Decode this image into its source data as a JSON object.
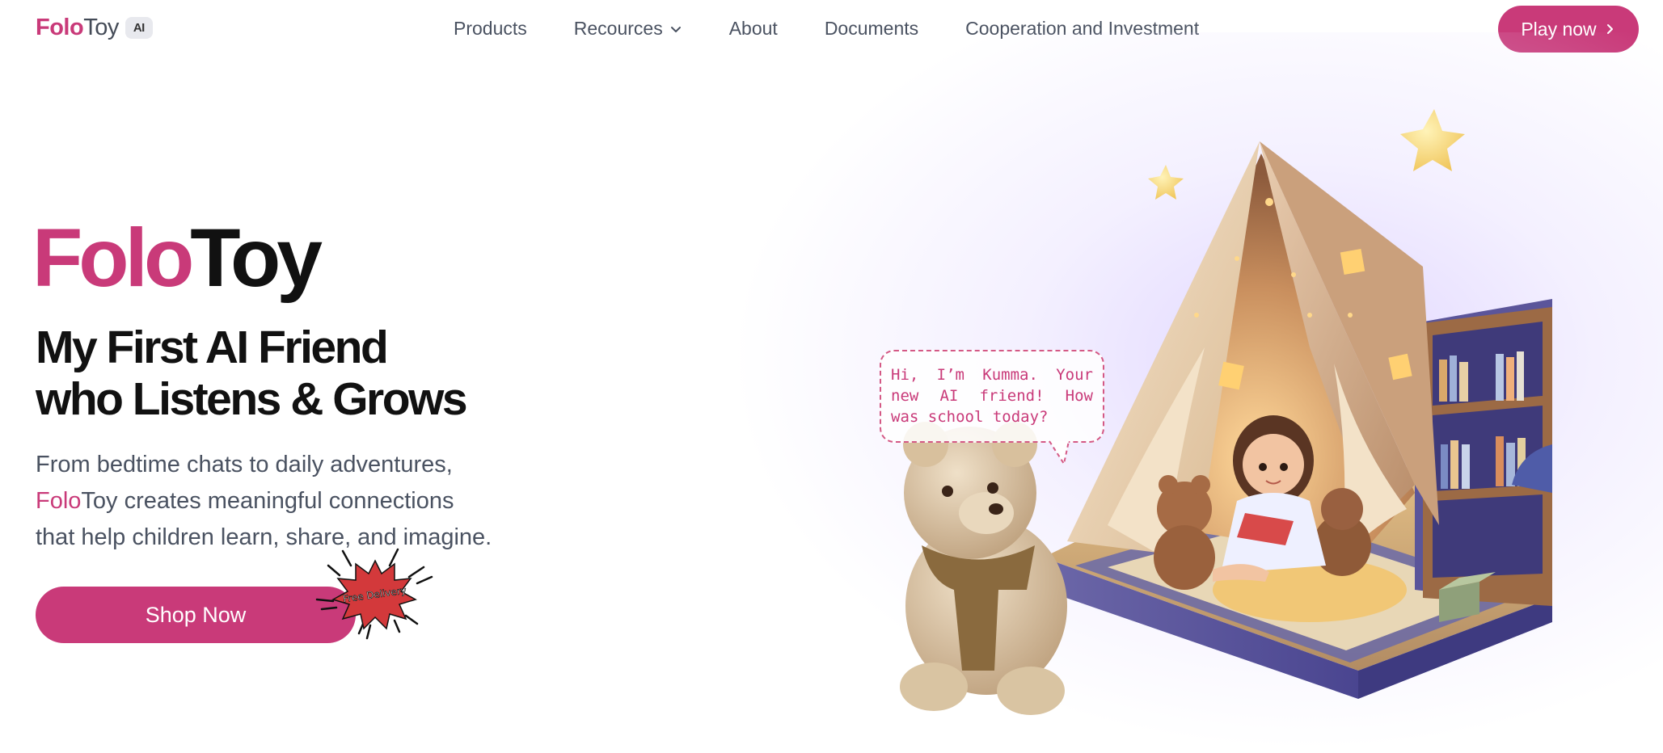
{
  "nav": {
    "logo_folo": "Folo",
    "logo_toy": "Toy",
    "logo_badge": "AI",
    "links": [
      {
        "label": "Products"
      },
      {
        "label": "Recources",
        "has_dropdown": true
      },
      {
        "label": "About"
      },
      {
        "label": "Documents"
      },
      {
        "label": "Cooperation and Investment"
      }
    ],
    "cta_label": "Play now"
  },
  "hero": {
    "brand_folo": "Folo",
    "brand_toy": "Toy",
    "headline_line1": "My First AI Friend",
    "headline_line2": "who Listens & Grows",
    "desc_line1": "From bedtime chats to daily adventures,",
    "desc_folo": "Folo",
    "desc_line2_rest": "Toy creates meaningful connections",
    "desc_line3": "that help children learn, share, and imagine.",
    "shop_label": "Shop Now",
    "badge_label": "Free Delivery"
  },
  "illustration": {
    "speech_bubble": "Hi, I’m Kumma. Your new AI friend! How was school today?"
  },
  "colors": {
    "brand_pink": "#c93a79",
    "text_gray": "#4a5261",
    "glow_lavender": "#d6c8ff"
  }
}
